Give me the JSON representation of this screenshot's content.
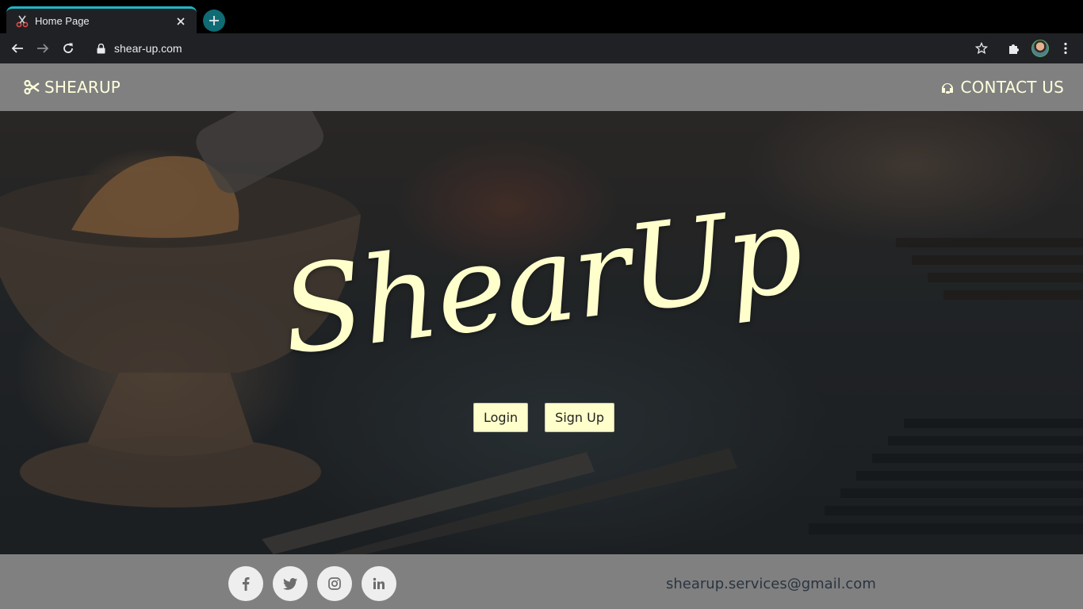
{
  "browser": {
    "tab_title": "Home Page",
    "url": "shear-up.com",
    "accent": "#1fb6c6"
  },
  "navbar": {
    "brand_label": "SHEARUP",
    "brand_icon": "scissors-icon",
    "contact_label": "CONTACT US",
    "contact_icon": "headset-icon",
    "background": "#808080",
    "text_color": "#ffffdd"
  },
  "hero": {
    "title": "ShearUp",
    "title_color": "#ffffcc",
    "login_label": "Login",
    "signup_label": "Sign Up"
  },
  "footer": {
    "socials": [
      {
        "name": "facebook",
        "glyph": "f"
      },
      {
        "name": "twitter",
        "glyph": "twitter-bird"
      },
      {
        "name": "instagram",
        "glyph": "instagram-glyph"
      },
      {
        "name": "linkedin",
        "glyph": "in"
      }
    ],
    "email": "shearup.services@gmail.com"
  }
}
